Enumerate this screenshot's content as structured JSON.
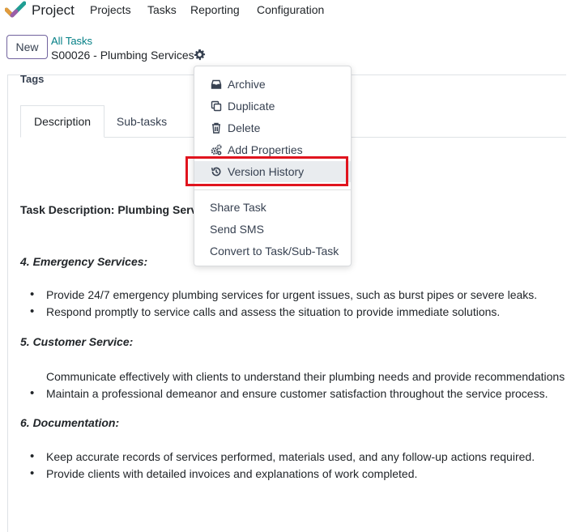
{
  "topnav": {
    "app_name": "Project",
    "items": [
      "Tasks",
      "Reporting",
      "Configuration"
    ],
    "project_label": "Projects"
  },
  "control": {
    "new_label": "New",
    "breadcrumb_parent": "All Tasks",
    "breadcrumb_current": "S00026 - Plumbing Services"
  },
  "form": {
    "tags_label": "Tags",
    "tabs": [
      "Description",
      "Sub-tasks"
    ],
    "active_tab": "Description"
  },
  "description": {
    "heading": "Task Description: Plumbing Serv",
    "sections": [
      {
        "title": "4. Emergency Services:",
        "bullets": [
          "Provide 24/7 emergency plumbing services for urgent issues, such as burst pipes or severe leaks.",
          "Respond promptly to service calls and assess the situation to provide immediate solutions."
        ]
      },
      {
        "title": "5. Customer Service:",
        "bullets": [
          "Communicate effectively with clients to understand their plumbing needs and provide recommendations",
          "Maintain a professional demeanor and ensure customer satisfaction throughout the service process."
        ]
      },
      {
        "title": "6. Documentation:",
        "bullets": [
          "Keep accurate records of services performed, materials used, and any follow-up actions required.",
          "Provide clients with detailed invoices and explanations of work completed."
        ]
      }
    ]
  },
  "gear_menu": {
    "items": [
      {
        "label": "Archive",
        "icon": "archive-icon"
      },
      {
        "label": "Duplicate",
        "icon": "copy-icon"
      },
      {
        "label": "Delete",
        "icon": "trash-icon"
      },
      {
        "label": "Add Properties",
        "icon": "cogs-icon"
      },
      {
        "label": "Version History",
        "icon": "history-icon"
      }
    ],
    "actions": [
      "Share Task",
      "Send SMS",
      "Convert to Task/Sub-Task"
    ],
    "highlighted": "Version History"
  },
  "colors": {
    "brand": "#71639e",
    "link": "#017e84",
    "highlight_box": "#e0141e"
  }
}
